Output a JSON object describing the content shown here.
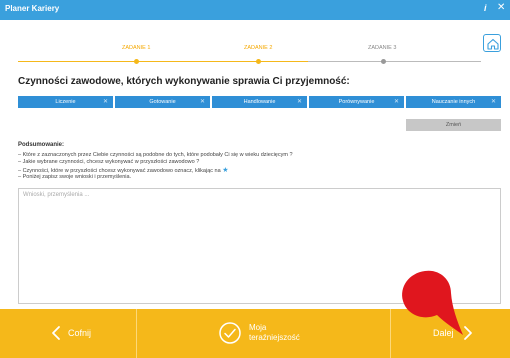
{
  "window": {
    "title": "Planer Kariery",
    "info_glyph": "i",
    "close_glyph": "✕"
  },
  "steps": [
    {
      "label": "ZADANIE 1",
      "state": "done"
    },
    {
      "label": "ZADANIE 2",
      "state": "current"
    },
    {
      "label": "ZADANIE 3",
      "state": "pending"
    }
  ],
  "main": {
    "heading": "Czynności zawodowe, których wykonywanie sprawia Ci przyjemność:",
    "tabs": [
      {
        "label": "Liczenie"
      },
      {
        "label": "Gotowanie"
      },
      {
        "label": "Handlowanie"
      },
      {
        "label": "Porównywanie"
      },
      {
        "label": "Nauczanie innych"
      }
    ],
    "tab_remove_glyph": "✕",
    "change_button": "Zmień",
    "summary": {
      "title": "Podsumowanie:",
      "lines": [
        "– Które z zaznaczonych przez Ciebie czynności są podobne do tych, które podobały Ci się w wieku dziecięcym ?",
        "– Jakie wybrane czynności, chcesz wykonywać w przyszłości zawodowo ?",
        "– Czynności, które w przyszłości chcesz wykonywać zawodowo oznacz, klikając na",
        "– Poniżej zapisz swoje wnioski i przemyślenia."
      ],
      "star_glyph": "★"
    },
    "notes": {
      "placeholder": "Wnioski, przemyślenia ...",
      "value": ""
    }
  },
  "footer": {
    "back_label": "Cofnij",
    "present_label": "Moja\nteraźniejszość",
    "next_label": "Dalej"
  },
  "colors": {
    "titlebar": "#3aa0dd",
    "tab": "#2f8fd6",
    "accent": "#f5b81a",
    "marker": "#e0161e"
  }
}
